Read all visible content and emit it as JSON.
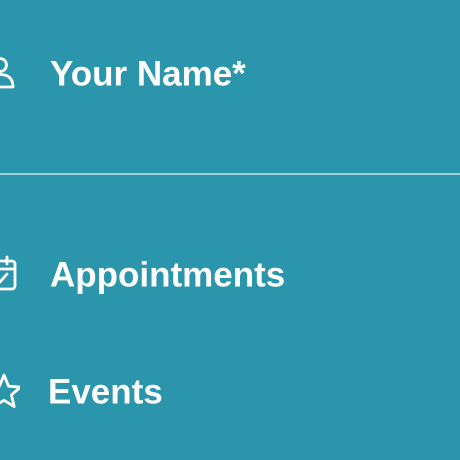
{
  "colors": {
    "background": "#2A95AB",
    "text": "#FFFFFF",
    "divider": "#9FCFDA"
  },
  "menu": {
    "profile": {
      "label": "Your Name*",
      "icon": "user-icon"
    },
    "items": [
      {
        "label": "Appointments",
        "icon": "calendar-icon"
      },
      {
        "label": "Events",
        "icon": "star-icon"
      }
    ]
  }
}
